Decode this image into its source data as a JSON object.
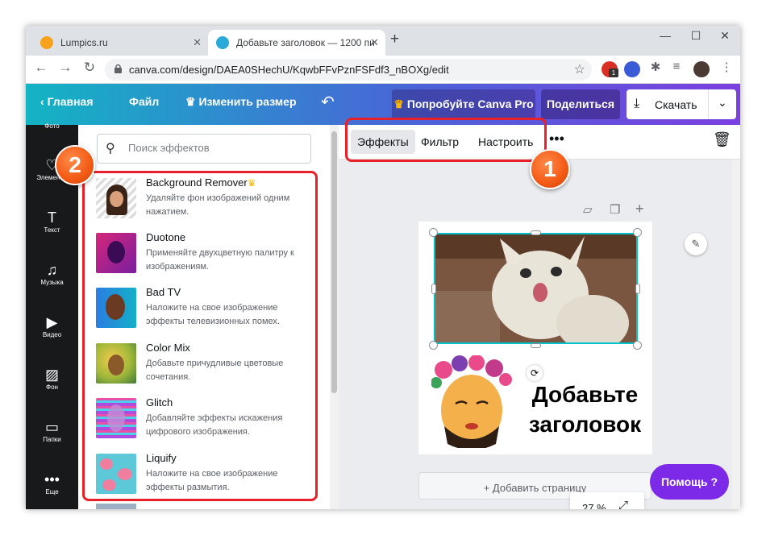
{
  "browser": {
    "tabs": [
      {
        "title": "Lumpics.ru"
      },
      {
        "title": "Добавьте заголовок — 1200 пи"
      }
    ],
    "new_tab": "+",
    "window_controls": {
      "minimize": "—",
      "maximize": "☐",
      "close": "✕"
    },
    "url": "canva.com/design/DAEA0SHechU/KqwbFFvPznFSFdf3_nBOXg/edit",
    "ext_badge": "1"
  },
  "header": {
    "home": "Главная",
    "file": "Файл",
    "resize": "Изменить размер",
    "try_pro": "Попробуйте Canva Pro",
    "share": "Поделиться",
    "download": "Скачать"
  },
  "sidebar": {
    "items": [
      {
        "label": "Фото",
        "icon": "photo-icon"
      },
      {
        "label": "Элементы",
        "icon": "elements-icon"
      },
      {
        "label": "Текст",
        "icon": "text-icon"
      },
      {
        "label": "Музыка",
        "icon": "music-icon"
      },
      {
        "label": "Видео",
        "icon": "video-icon"
      },
      {
        "label": "Фон",
        "icon": "background-icon"
      },
      {
        "label": "Папки",
        "icon": "folder-icon"
      },
      {
        "label": "Еще",
        "icon": "more-icon"
      }
    ]
  },
  "panel": {
    "search_placeholder": "Поиск эффектов",
    "effects": [
      {
        "name": "Background Remover",
        "desc": "Удаляйте фон изображений одним нажатием."
      },
      {
        "name": "Duotone",
        "desc": "Применяйте двухцветную палитру к изображениям."
      },
      {
        "name": "Bad TV",
        "desc": "Наложите на свое изображение эффекты телевизионных помех."
      },
      {
        "name": "Color Mix",
        "desc": "Добавьте причудливые цветовые сочетания."
      },
      {
        "name": "Glitch",
        "desc": "Добавляйте эффекты искажения цифрового изображения."
      },
      {
        "name": "Liquify",
        "desc": "Наложите на свое изображение эффекты размытия."
      }
    ]
  },
  "toolbar": {
    "effects": "Эффекты",
    "filter": "Фильтр",
    "adjust": "Настроить",
    "more": "•••"
  },
  "canvas": {
    "heading": "Добавьте заголовок",
    "add_page": "+ Добавить страницу",
    "zoom": "27 %"
  },
  "help": {
    "label": "Помощь ?"
  },
  "annotations": {
    "badge1": "1",
    "badge2": "2"
  },
  "colors": {
    "accent": "#7d2ae8",
    "highlight": "#e8202a",
    "selection": "#00c4cc"
  }
}
